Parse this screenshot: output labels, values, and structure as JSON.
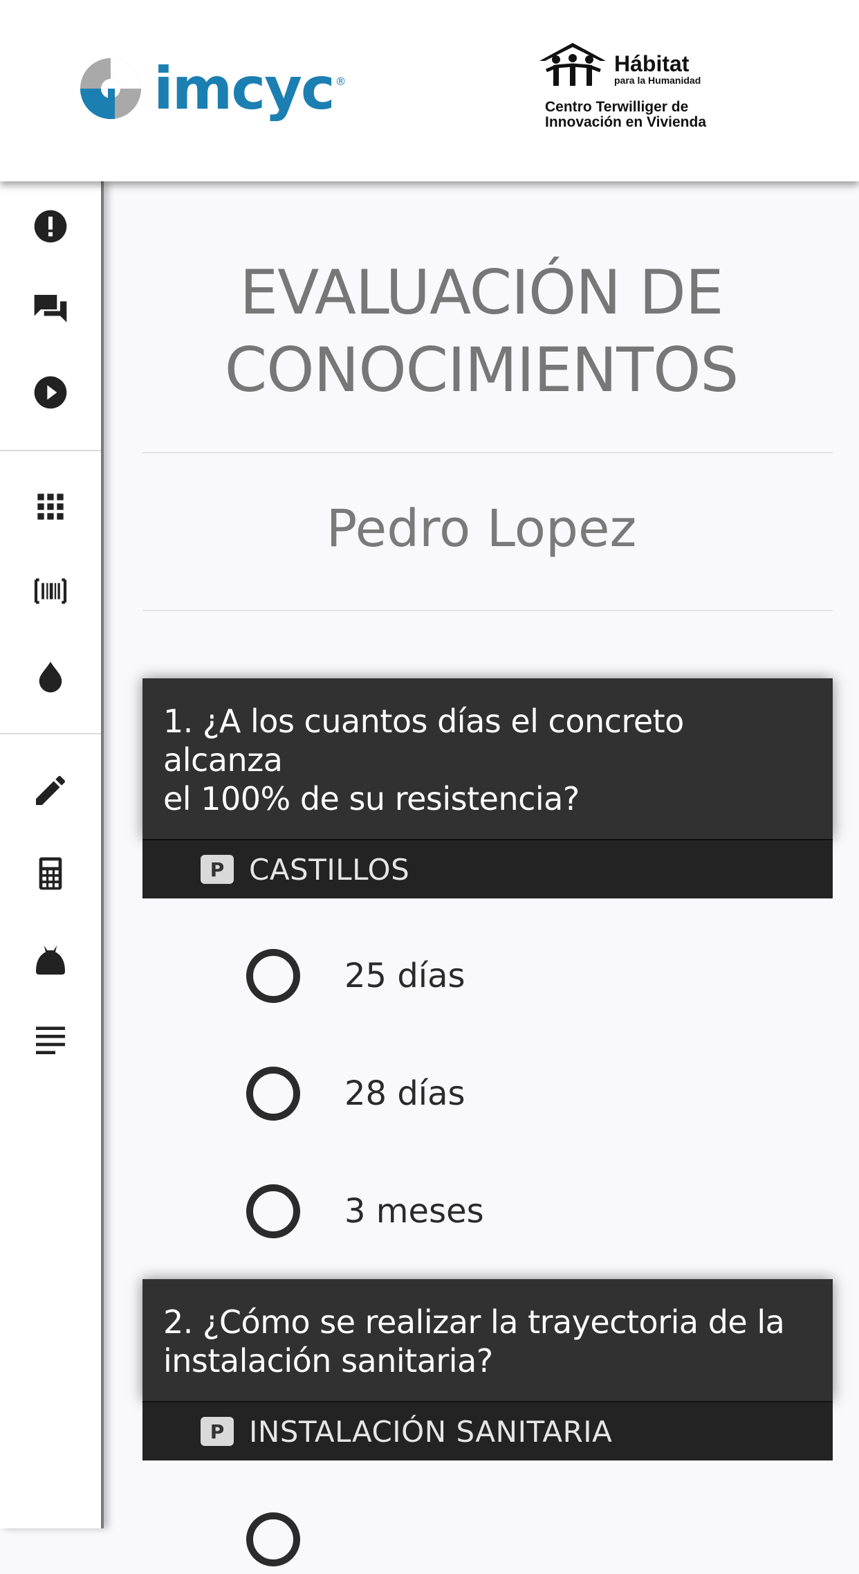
{
  "header": {
    "logo_left_text": "imcyc",
    "logo_right_name": "Hábitat",
    "logo_right_sub": "para la Humanidad",
    "logo_right_center_line1": "Centro Terwilliger de",
    "logo_right_center_line2": "Innovación en Vivienda"
  },
  "sidebar": {
    "items": [
      {
        "icon": "alert-circle-icon"
      },
      {
        "icon": "chat-icon"
      },
      {
        "icon": "play-circle-icon"
      },
      {
        "icon": "grid-icon"
      },
      {
        "icon": "barcode-icon"
      },
      {
        "icon": "drop-icon"
      },
      {
        "icon": "pencil-icon"
      },
      {
        "icon": "calculator-icon"
      },
      {
        "icon": "bag-icon"
      },
      {
        "icon": "text-lines-icon"
      }
    ]
  },
  "main": {
    "title_line1": "EVALUACIÓN DE",
    "title_line2": "CONOCIMIENTOS",
    "student_name": "Pedro Lopez",
    "questions": [
      {
        "text_line1": "1. ¿A los cuantos días el concreto alcanza",
        "text_line2": "el 100% de su resistencia?",
        "badge": "P",
        "category": "CASTILLOS",
        "options": [
          "25 días",
          "28 días",
          "3 meses"
        ]
      },
      {
        "text_line1": "2. ¿Cómo se realizar la trayectoria de la",
        "text_line2": "instalación sanitaria?",
        "badge": "P",
        "category": "INSTALACIÓN SANITARIA"
      }
    ]
  },
  "colors": {
    "brand_blue": "#1b7fb2",
    "question_header": "#313131",
    "category_bar": "#232323",
    "background": "#f9f9fb"
  }
}
